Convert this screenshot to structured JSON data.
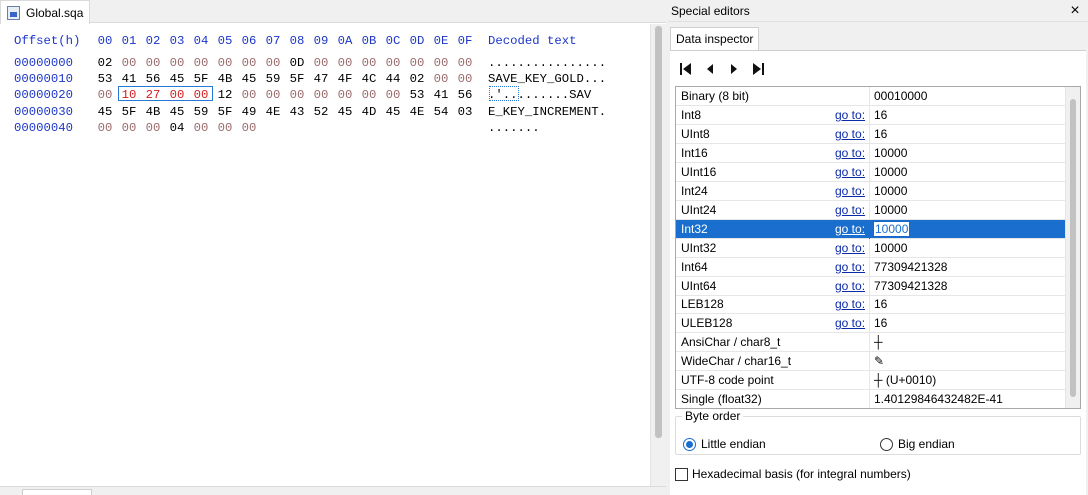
{
  "file_tab": {
    "label": "Global.sqa"
  },
  "hex_editor": {
    "offset_header": "Offset(h)",
    "column_headers": [
      "00",
      "01",
      "02",
      "03",
      "04",
      "05",
      "06",
      "07",
      "08",
      "09",
      "0A",
      "0B",
      "0C",
      "0D",
      "0E",
      "0F"
    ],
    "decoded_header": "Decoded text",
    "rows": [
      {
        "offset": "00000000",
        "bytes": [
          "02",
          "00",
          "00",
          "00",
          "00",
          "00",
          "00",
          "00",
          "0D",
          "00",
          "00",
          "00",
          "00",
          "00",
          "00",
          "00"
        ],
        "decoded": "................"
      },
      {
        "offset": "00000010",
        "bytes": [
          "53",
          "41",
          "56",
          "45",
          "5F",
          "4B",
          "45",
          "59",
          "5F",
          "47",
          "4F",
          "4C",
          "44",
          "02",
          "00",
          "00"
        ],
        "decoded": "SAVE_KEY_GOLD..."
      },
      {
        "offset": "00000020",
        "bytes": [
          "00",
          "10",
          "27",
          "00",
          "00",
          "12",
          "00",
          "00",
          "00",
          "00",
          "00",
          "00",
          "00",
          "53",
          "41",
          "56"
        ],
        "decoded": ".'.........SAV"
      },
      {
        "offset": "00000030",
        "bytes": [
          "45",
          "5F",
          "4B",
          "45",
          "59",
          "5F",
          "49",
          "4E",
          "43",
          "52",
          "45",
          "4D",
          "45",
          "4E",
          "54",
          "03"
        ],
        "decoded": "E_KEY_INCREMENT."
      },
      {
        "offset": "00000040",
        "bytes": [
          "00",
          "00",
          "00",
          "04",
          "00",
          "00",
          "00"
        ],
        "decoded": "......."
      }
    ],
    "selected_bytes_row": 2,
    "selected_bytes_range": [
      1,
      4
    ]
  },
  "special_editors": {
    "title": "Special editors",
    "close_label": "×",
    "tab_label": "Data inspector",
    "nav_icons": [
      "first-icon",
      "previous-icon",
      "next-icon",
      "last-icon"
    ],
    "goto_label": "go to:",
    "rows": [
      {
        "name": "Binary (8 bit)",
        "goto": false,
        "value": "00010000"
      },
      {
        "name": "Int8",
        "goto": true,
        "value": "16"
      },
      {
        "name": "UInt8",
        "goto": true,
        "value": "16"
      },
      {
        "name": "Int16",
        "goto": true,
        "value": "10000"
      },
      {
        "name": "UInt16",
        "goto": true,
        "value": "10000"
      },
      {
        "name": "Int24",
        "goto": true,
        "value": "10000"
      },
      {
        "name": "UInt24",
        "goto": true,
        "value": "10000"
      },
      {
        "name": "Int32",
        "goto": true,
        "value": "10000",
        "selected": true
      },
      {
        "name": "UInt32",
        "goto": true,
        "value": "10000"
      },
      {
        "name": "Int64",
        "goto": true,
        "value": "77309421328"
      },
      {
        "name": "UInt64",
        "goto": true,
        "value": "77309421328"
      },
      {
        "name": "LEB128",
        "goto": true,
        "value": "16"
      },
      {
        "name": "ULEB128",
        "goto": true,
        "value": "16"
      },
      {
        "name": "AnsiChar / char8_t",
        "goto": false,
        "value": "┼"
      },
      {
        "name": "WideChar / char16_t",
        "goto": false,
        "value": "✎"
      },
      {
        "name": "UTF-8 code point",
        "goto": false,
        "value": "┼ (U+0010)"
      },
      {
        "name": "Single (float32)",
        "goto": false,
        "value": "1.40129846432482E-41"
      }
    ],
    "byte_order": {
      "legend": "Byte order",
      "little_endian": "Little endian",
      "big_endian": "Big endian",
      "selected": "little"
    },
    "hex_basis_label": "Hexadecimal basis (for integral numbers)",
    "hex_basis_checked": false
  },
  "colors": {
    "offset_blue": "#1c36c8",
    "selection_blue": "#1a6ecd",
    "selected_bytes_red": "#d32020",
    "zero_byte": "#9c6a6a"
  }
}
